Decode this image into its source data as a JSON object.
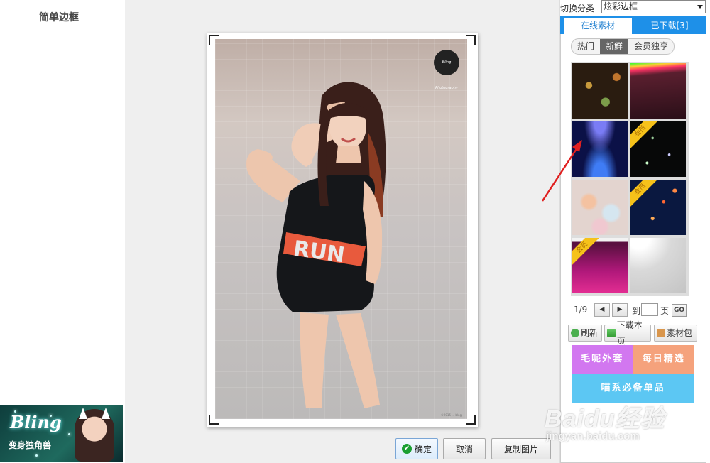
{
  "left": {
    "title": "简单边框",
    "promo": {
      "script": "Bling",
      "subtitle": "变身独角兽"
    }
  },
  "canvas": {
    "photo_logo": "Bling Photography",
    "photo_credit": "©2015 ... blog",
    "buttons": {
      "ok": "确定",
      "cancel": "取消",
      "copy": "复制图片"
    }
  },
  "right": {
    "category_label": "切换分类",
    "category_value": "炫彩边框",
    "tabs": {
      "online": "在线素材",
      "downloaded": "已下载[3]"
    },
    "subtabs": [
      "热门",
      "新鲜",
      "会员独享"
    ],
    "active_subtab": "新鲜",
    "vip_badge": "会员",
    "thumbnails": [
      {
        "name": "bokeh-gold",
        "vip": false
      },
      {
        "name": "rainbow-dark",
        "vip": false
      },
      {
        "name": "blue-glow",
        "vip": false
      },
      {
        "name": "black-glitter",
        "vip": true
      },
      {
        "name": "pastel-bokeh",
        "vip": false
      },
      {
        "name": "navy-stars",
        "vip": true
      },
      {
        "name": "magenta-sparkle",
        "vip": true
      },
      {
        "name": "grey-rays",
        "vip": false
      }
    ],
    "pager": {
      "page": "1/9",
      "to_label": "到",
      "page_label": "页",
      "go": "GO"
    },
    "tools": {
      "refresh": "刷新",
      "download_page": "下载本页",
      "pack": "素材包"
    },
    "banners": {
      "a": "毛呢外套",
      "b": "每日精选",
      "c": "喵系必备单品"
    }
  },
  "watermark": {
    "main": "Baidu经验",
    "sub": "jingyan.baidu.com"
  },
  "colors": {
    "accent": "#1e90e8",
    "ok_check": "#1a9f32",
    "vip": "#f6c21a"
  }
}
